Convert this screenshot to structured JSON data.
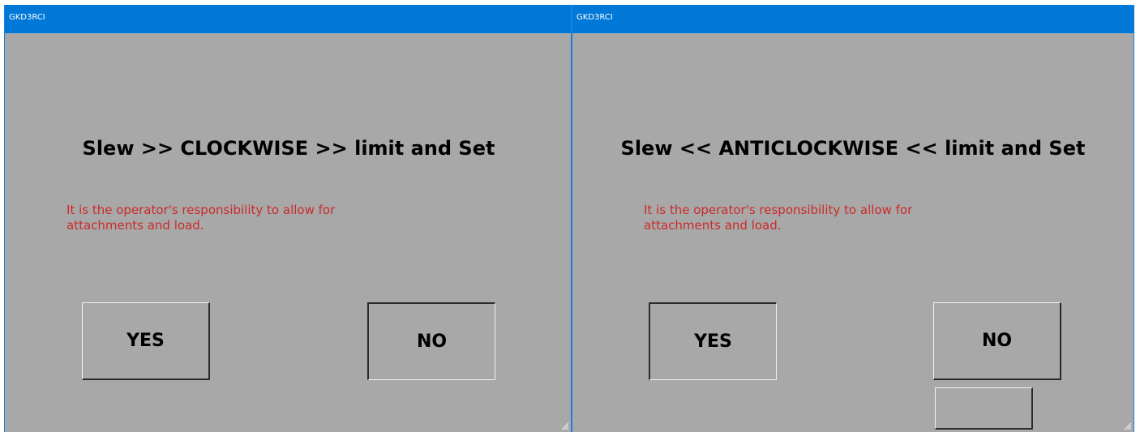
{
  "windows": [
    {
      "title": "GKD3RCI",
      "heading": "Slew >> CLOCKWISE >> limit and Set",
      "warning": "It is the operator's responsibility to allow for attachments and load.",
      "yes_label": "YES",
      "no_label": "NO"
    },
    {
      "title": "GKD3RCI",
      "heading": "Slew << ANTICLOCKWISE << limit and Set",
      "warning": "It is the operator's responsibility to allow for attachments and load.",
      "yes_label": "YES",
      "no_label": "NO"
    }
  ],
  "colors": {
    "titlebar": "#0078d7",
    "window_background": "#a8a8a8",
    "warning_text": "#cc2a2a"
  },
  "icons": [
    "resize-grip-icon"
  ]
}
